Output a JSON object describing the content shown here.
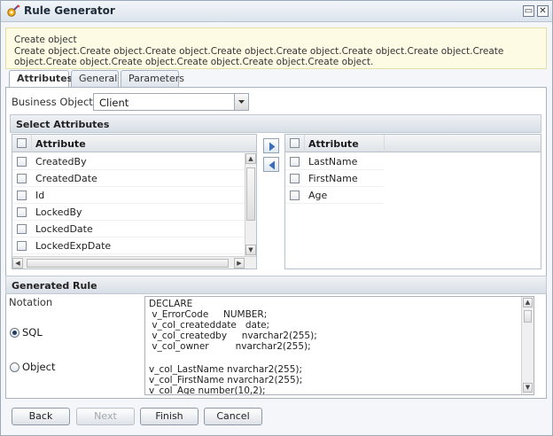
{
  "window": {
    "title": "Rule Generator",
    "minimize_glyph": "▭",
    "close_glyph": "✕"
  },
  "info": {
    "text": "Create object\nCreate object.Create object.Create object.Create object.Create object.Create object.Create object.Create object.Create object.Create object.Create object.Create object.Create object."
  },
  "tabs": [
    {
      "label": "Attributes",
      "active": true
    },
    {
      "label": "General",
      "active": false
    },
    {
      "label": "Parameters",
      "active": false
    }
  ],
  "business_object": {
    "label": "Business Object:",
    "value": "Client"
  },
  "select_attributes": {
    "title": "Select Attributes",
    "left_header": "Attribute",
    "left_items": [
      "CreatedBy",
      "CreatedDate",
      "Id",
      "LockedBy",
      "LockedDate",
      "LockedExpDate"
    ],
    "right_header": "Attribute",
    "right_items": [
      "LastName",
      "FirstName",
      "Age"
    ]
  },
  "generated_rule": {
    "title": "Generated Rule",
    "notation_label": "Notation",
    "options": [
      {
        "label": "SQL",
        "checked": true
      },
      {
        "label": "Object",
        "checked": false
      }
    ],
    "code_lines": [
      "DECLARE",
      " v_ErrorCode     NUMBER;",
      " v_col_createddate   date;",
      " v_col_createdby     nvarchar2(255);",
      " v_col_owner         nvarchar2(255);",
      "",
      "v_col_LastName nvarchar2(255);",
      "v_col_FirstName nvarchar2(255);",
      "v_col_Age number(10,2);"
    ]
  },
  "buttons": {
    "back": "Back",
    "next": "Next",
    "finish": "Finish",
    "cancel": "Cancel"
  },
  "icons": {
    "title_icon": "gear-wand-icon",
    "add_arrow": "arrow-right-icon",
    "remove_arrow": "arrow-left-icon"
  },
  "colors": {
    "accent": "#3b6fb5",
    "info_bg": "#fdfbe3",
    "header_bg": "#dfe5ec"
  }
}
